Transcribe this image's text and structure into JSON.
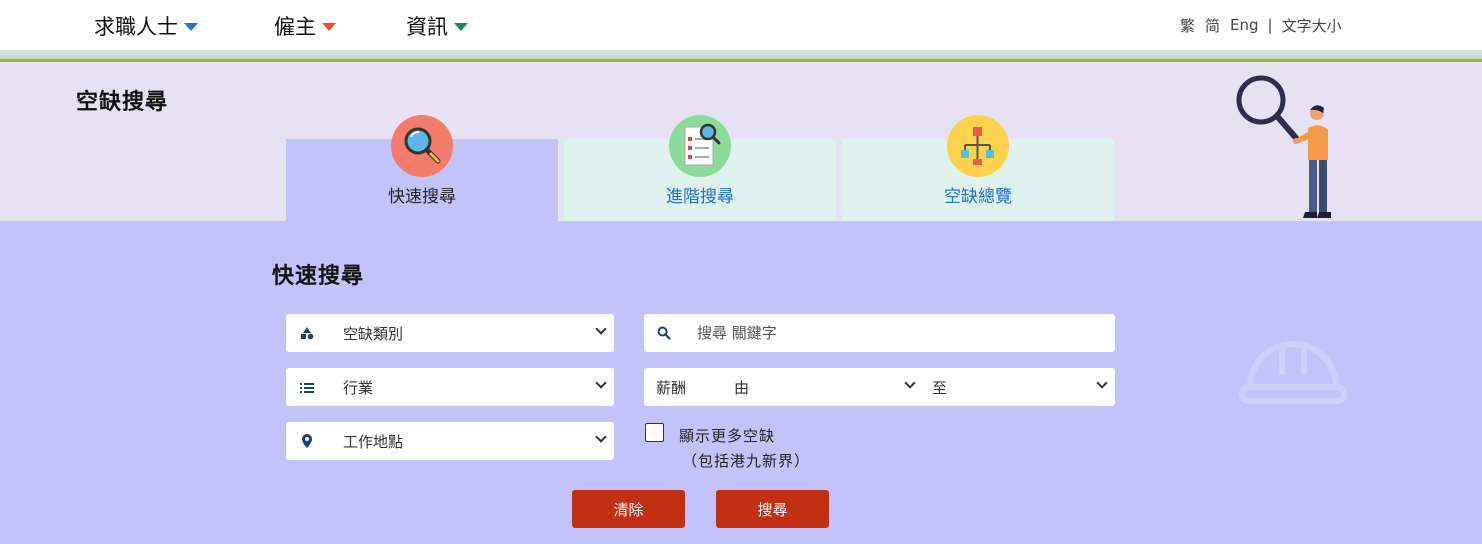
{
  "nav": {
    "items": [
      {
        "label": "求職人士",
        "color": "#1a7ad8"
      },
      {
        "label": "僱主",
        "color": "#e0541e"
      },
      {
        "label": "資訊",
        "color": "#12865e"
      }
    ],
    "utility": {
      "trad": "繁",
      "simp": "简",
      "eng": "Eng",
      "separator": "|",
      "font_size": "文字大小"
    }
  },
  "page": {
    "title": "空缺搜尋"
  },
  "tabs": [
    {
      "label": "快速搜尋",
      "icon": "magnifier-icon",
      "icon_bg": "#f47c6a",
      "active": true
    },
    {
      "label": "進階搜尋",
      "icon": "checklist-search-icon",
      "icon_bg": "#8ddb9a",
      "active": false
    },
    {
      "label": "空缺總覽",
      "icon": "org-chart-icon",
      "icon_bg": "#fcd24c",
      "active": false
    }
  ],
  "form": {
    "title": "快速搜尋",
    "category": "空缺類別",
    "industry": "行業",
    "location": "工作地點",
    "keyword_placeholder": "搜尋 關鍵字",
    "salary_label": "薪酬",
    "salary_from": "由",
    "salary_to": "至",
    "more_line1": "顯示更多空缺",
    "more_line2": "（包括港九新界）",
    "clear": "清除",
    "search": "搜尋"
  },
  "colors": {
    "accent_green": "#93c01f",
    "button_red": "#c22f12",
    "panel": "#c3c3fb",
    "header_bg": "#e6e2f4",
    "link_blue": "#1f6fd6"
  }
}
